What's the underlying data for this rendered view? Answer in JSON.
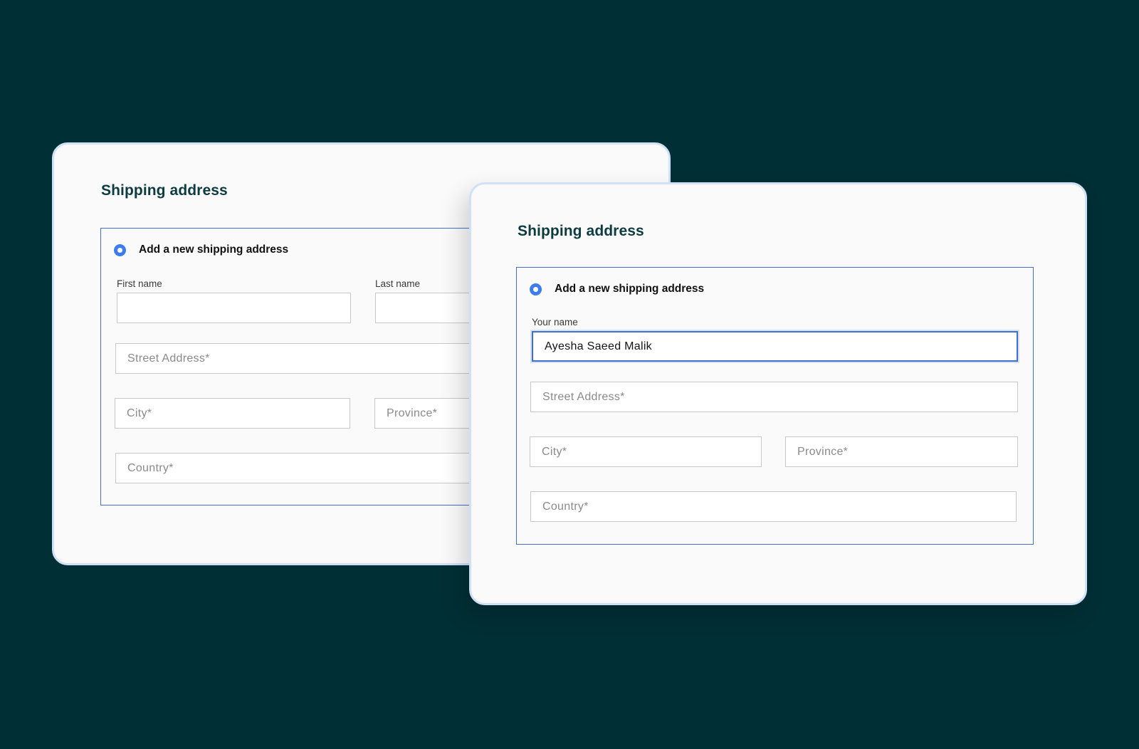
{
  "back_card": {
    "title": "Shipping address",
    "option_label": "Add a new shipping address",
    "first_name_label": "First name",
    "last_name_label": "Last name",
    "first_name_value": "",
    "last_name_value": "",
    "street_placeholder": "Street Address*",
    "city_placeholder": "City*",
    "province_placeholder": "Province*",
    "country_placeholder": "Country*"
  },
  "front_card": {
    "title": "Shipping address",
    "option_label": "Add a new shipping address",
    "name_label": "Your name",
    "name_value": "Ayesha Saeed Malik",
    "street_placeholder": "Street Address*",
    "city_placeholder": "City*",
    "province_placeholder": "Province*",
    "country_placeholder": "Country*"
  },
  "colors": {
    "background": "#002f35",
    "card": "#fafafa",
    "card_border": "#cfe0f7",
    "accent": "#3f6fd1",
    "radio": "#3d7bf0",
    "title": "#0c3b40"
  },
  "icons": {
    "radio": "radio-selected-icon"
  }
}
